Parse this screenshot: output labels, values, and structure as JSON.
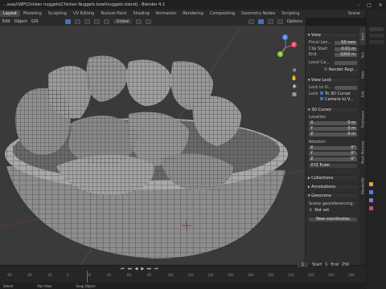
{
  "titlebar": {
    "title": "...ssayi\\WP\\Chicken nuggets\\Chicken Nuggets bowl\\nuggets.blend] - Blender 4.1"
  },
  "menubar": {
    "tabs": [
      "Layout",
      "Modeling",
      "Sculpting",
      "UV Editing",
      "Texture Paint",
      "Shading",
      "Animation",
      "Rendering",
      "Compositing",
      "Geometry Nodes",
      "Scripting"
    ],
    "scene": "Scene"
  },
  "viewhdr": {
    "items": [
      "Edit",
      "Object",
      "GIS"
    ],
    "global": "Global",
    "options": "Options"
  },
  "npanel": {
    "view_header": "View",
    "focal_label": "Focal Len...",
    "focal_value": "50 mm",
    "clip_start_label": "Clip Start",
    "clip_start_value": "0.01 m",
    "end_label": "End",
    "end_value": "1000 m",
    "local_camera_label": "Local Ca...",
    "render_region": "Render Regi...",
    "view_lock_header": "View Lock",
    "lock_to_obj": "Lock to O...",
    "lock_label": "Lock",
    "to_3d_cursor": "To 3D Cursor",
    "camera_to_view": "Camera to V...",
    "cursor_header": "3D Cursor",
    "location_label": "Location",
    "loc_x": "X",
    "loc_x_val": "0 m",
    "loc_y": "Y",
    "loc_y_val": "0 m",
    "loc_z": "Z",
    "loc_z_val": "0 m",
    "rotation_label": "Rotation",
    "rot_x": "X",
    "rot_x_val": "0°",
    "rot_y": "Y",
    "rot_y_val": "0°",
    "rot_z": "Z",
    "rot_z_val": "0°",
    "euler": "XYZ Euler",
    "collections": "Collections",
    "annotations": "Annotations",
    "geoscene": "Geoscene",
    "georef": "Scene georeferencing :",
    "not_set": "Not set",
    "new_coords": "New coordinates"
  },
  "tabstrip": [
    "Item",
    "Tool",
    "View",
    "Edit",
    "PolyHaven",
    "Mesh Machine",
    "BlenderKit"
  ],
  "timeline": {
    "frames": [
      "-60",
      "-40",
      "-20",
      "0",
      "20",
      "40",
      "60",
      "80",
      "100",
      "120",
      "140",
      "160",
      "180",
      "200",
      "220",
      "240",
      "260",
      "280"
    ],
    "current": "1",
    "start_label": "Start",
    "start_value": "1",
    "end_label": "End",
    "end_value": "250"
  },
  "statusbar": {
    "select": "Select",
    "pan": "Pan View",
    "context": "Snap Object"
  },
  "colors": {
    "accent": "#4772b3",
    "x_axis": "#e84a5f",
    "y_axis": "#8cc63f",
    "z_axis": "#4a7fe8"
  }
}
